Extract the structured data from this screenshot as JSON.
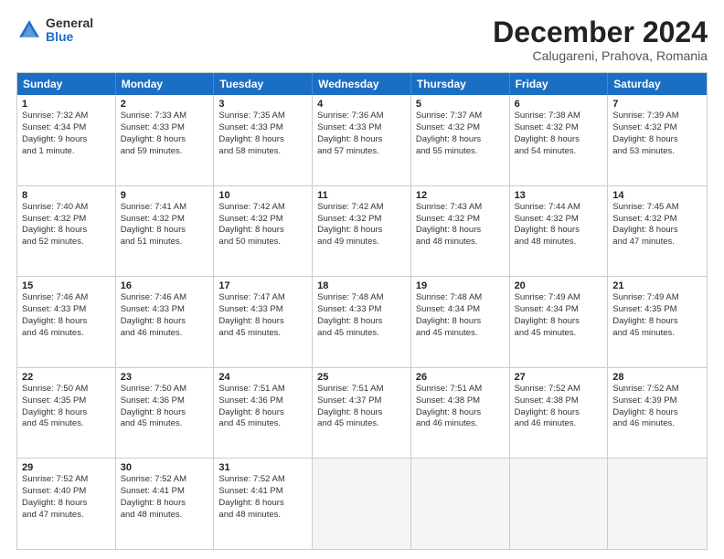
{
  "logo": {
    "general": "General",
    "blue": "Blue"
  },
  "title": "December 2024",
  "subtitle": "Calugareni, Prahova, Romania",
  "header_days": [
    "Sunday",
    "Monday",
    "Tuesday",
    "Wednesday",
    "Thursday",
    "Friday",
    "Saturday"
  ],
  "rows": [
    [
      {
        "day": "1",
        "line1": "Sunrise: 7:32 AM",
        "line2": "Sunset: 4:34 PM",
        "line3": "Daylight: 9 hours",
        "line4": "and 1 minute."
      },
      {
        "day": "2",
        "line1": "Sunrise: 7:33 AM",
        "line2": "Sunset: 4:33 PM",
        "line3": "Daylight: 8 hours",
        "line4": "and 59 minutes."
      },
      {
        "day": "3",
        "line1": "Sunrise: 7:35 AM",
        "line2": "Sunset: 4:33 PM",
        "line3": "Daylight: 8 hours",
        "line4": "and 58 minutes."
      },
      {
        "day": "4",
        "line1": "Sunrise: 7:36 AM",
        "line2": "Sunset: 4:33 PM",
        "line3": "Daylight: 8 hours",
        "line4": "and 57 minutes."
      },
      {
        "day": "5",
        "line1": "Sunrise: 7:37 AM",
        "line2": "Sunset: 4:32 PM",
        "line3": "Daylight: 8 hours",
        "line4": "and 55 minutes."
      },
      {
        "day": "6",
        "line1": "Sunrise: 7:38 AM",
        "line2": "Sunset: 4:32 PM",
        "line3": "Daylight: 8 hours",
        "line4": "and 54 minutes."
      },
      {
        "day": "7",
        "line1": "Sunrise: 7:39 AM",
        "line2": "Sunset: 4:32 PM",
        "line3": "Daylight: 8 hours",
        "line4": "and 53 minutes."
      }
    ],
    [
      {
        "day": "8",
        "line1": "Sunrise: 7:40 AM",
        "line2": "Sunset: 4:32 PM",
        "line3": "Daylight: 8 hours",
        "line4": "and 52 minutes."
      },
      {
        "day": "9",
        "line1": "Sunrise: 7:41 AM",
        "line2": "Sunset: 4:32 PM",
        "line3": "Daylight: 8 hours",
        "line4": "and 51 minutes."
      },
      {
        "day": "10",
        "line1": "Sunrise: 7:42 AM",
        "line2": "Sunset: 4:32 PM",
        "line3": "Daylight: 8 hours",
        "line4": "and 50 minutes."
      },
      {
        "day": "11",
        "line1": "Sunrise: 7:42 AM",
        "line2": "Sunset: 4:32 PM",
        "line3": "Daylight: 8 hours",
        "line4": "and 49 minutes."
      },
      {
        "day": "12",
        "line1": "Sunrise: 7:43 AM",
        "line2": "Sunset: 4:32 PM",
        "line3": "Daylight: 8 hours",
        "line4": "and 48 minutes."
      },
      {
        "day": "13",
        "line1": "Sunrise: 7:44 AM",
        "line2": "Sunset: 4:32 PM",
        "line3": "Daylight: 8 hours",
        "line4": "and 48 minutes."
      },
      {
        "day": "14",
        "line1": "Sunrise: 7:45 AM",
        "line2": "Sunset: 4:32 PM",
        "line3": "Daylight: 8 hours",
        "line4": "and 47 minutes."
      }
    ],
    [
      {
        "day": "15",
        "line1": "Sunrise: 7:46 AM",
        "line2": "Sunset: 4:33 PM",
        "line3": "Daylight: 8 hours",
        "line4": "and 46 minutes."
      },
      {
        "day": "16",
        "line1": "Sunrise: 7:46 AM",
        "line2": "Sunset: 4:33 PM",
        "line3": "Daylight: 8 hours",
        "line4": "and 46 minutes."
      },
      {
        "day": "17",
        "line1": "Sunrise: 7:47 AM",
        "line2": "Sunset: 4:33 PM",
        "line3": "Daylight: 8 hours",
        "line4": "and 45 minutes."
      },
      {
        "day": "18",
        "line1": "Sunrise: 7:48 AM",
        "line2": "Sunset: 4:33 PM",
        "line3": "Daylight: 8 hours",
        "line4": "and 45 minutes."
      },
      {
        "day": "19",
        "line1": "Sunrise: 7:48 AM",
        "line2": "Sunset: 4:34 PM",
        "line3": "Daylight: 8 hours",
        "line4": "and 45 minutes."
      },
      {
        "day": "20",
        "line1": "Sunrise: 7:49 AM",
        "line2": "Sunset: 4:34 PM",
        "line3": "Daylight: 8 hours",
        "line4": "and 45 minutes."
      },
      {
        "day": "21",
        "line1": "Sunrise: 7:49 AM",
        "line2": "Sunset: 4:35 PM",
        "line3": "Daylight: 8 hours",
        "line4": "and 45 minutes."
      }
    ],
    [
      {
        "day": "22",
        "line1": "Sunrise: 7:50 AM",
        "line2": "Sunset: 4:35 PM",
        "line3": "Daylight: 8 hours",
        "line4": "and 45 minutes."
      },
      {
        "day": "23",
        "line1": "Sunrise: 7:50 AM",
        "line2": "Sunset: 4:36 PM",
        "line3": "Daylight: 8 hours",
        "line4": "and 45 minutes."
      },
      {
        "day": "24",
        "line1": "Sunrise: 7:51 AM",
        "line2": "Sunset: 4:36 PM",
        "line3": "Daylight: 8 hours",
        "line4": "and 45 minutes."
      },
      {
        "day": "25",
        "line1": "Sunrise: 7:51 AM",
        "line2": "Sunset: 4:37 PM",
        "line3": "Daylight: 8 hours",
        "line4": "and 45 minutes."
      },
      {
        "day": "26",
        "line1": "Sunrise: 7:51 AM",
        "line2": "Sunset: 4:38 PM",
        "line3": "Daylight: 8 hours",
        "line4": "and 46 minutes."
      },
      {
        "day": "27",
        "line1": "Sunrise: 7:52 AM",
        "line2": "Sunset: 4:38 PM",
        "line3": "Daylight: 8 hours",
        "line4": "and 46 minutes."
      },
      {
        "day": "28",
        "line1": "Sunrise: 7:52 AM",
        "line2": "Sunset: 4:39 PM",
        "line3": "Daylight: 8 hours",
        "line4": "and 46 minutes."
      }
    ],
    [
      {
        "day": "29",
        "line1": "Sunrise: 7:52 AM",
        "line2": "Sunset: 4:40 PM",
        "line3": "Daylight: 8 hours",
        "line4": "and 47 minutes."
      },
      {
        "day": "30",
        "line1": "Sunrise: 7:52 AM",
        "line2": "Sunset: 4:41 PM",
        "line3": "Daylight: 8 hours",
        "line4": "and 48 minutes."
      },
      {
        "day": "31",
        "line1": "Sunrise: 7:52 AM",
        "line2": "Sunset: 4:41 PM",
        "line3": "Daylight: 8 hours",
        "line4": "and 48 minutes."
      },
      {
        "day": "",
        "line1": "",
        "line2": "",
        "line3": "",
        "line4": ""
      },
      {
        "day": "",
        "line1": "",
        "line2": "",
        "line3": "",
        "line4": ""
      },
      {
        "day": "",
        "line1": "",
        "line2": "",
        "line3": "",
        "line4": ""
      },
      {
        "day": "",
        "line1": "",
        "line2": "",
        "line3": "",
        "line4": ""
      }
    ]
  ]
}
